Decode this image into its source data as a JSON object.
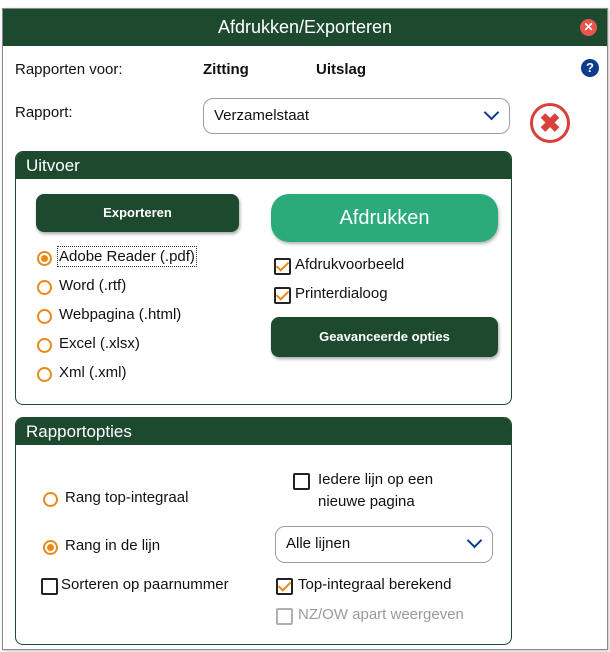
{
  "window": {
    "title": "Afdrukken/Exporteren",
    "close_glyph": "✕"
  },
  "header": {
    "reports_for_label": "Rapporten voor:",
    "tab_zitting": "Zitting",
    "tab_uitslag": "Uitslag",
    "help_glyph": "?"
  },
  "rapport": {
    "label": "Rapport:",
    "selected": "Verzamelstaat"
  },
  "close_icon_glyph": "✖",
  "uitvoer": {
    "title": "Uitvoer",
    "export_label": "Exporteren",
    "print_label": "Afdrukken",
    "advanced_label": "Geavanceerde opties",
    "formats": [
      {
        "label": "Adobe Reader (.pdf)",
        "selected": true
      },
      {
        "label": "Word (.rtf)",
        "selected": false
      },
      {
        "label": "Webpagina (.html)",
        "selected": false
      },
      {
        "label": "Excel (.xlsx)",
        "selected": false
      },
      {
        "label": "Xml (.xml)",
        "selected": false
      }
    ],
    "print_preview": {
      "label": "Afdrukvoorbeeld",
      "checked": true
    },
    "printer_dialog": {
      "label": "Printerdialoog",
      "checked": true
    }
  },
  "rapportopties": {
    "title": "Rapportopties",
    "rang_top": {
      "label": "Rang top-integraal",
      "selected": false
    },
    "rang_lijn": {
      "label": "Rang in de lijn",
      "selected": true
    },
    "new_page_line1": "Iedere lijn op een",
    "new_page_line2": "nieuwe pagina",
    "new_page_checked": false,
    "lines_select": "Alle lijnen",
    "sort_pair": {
      "label": "Sorteren op paarnummer",
      "checked": false
    },
    "top_integral": {
      "label": "Top-integraal berekend",
      "checked": true
    },
    "nz_ow": {
      "label": "NZ/OW apart weergeven",
      "checked": false,
      "disabled": true
    }
  },
  "colors": {
    "dark_green": "#1d4a2e",
    "accent_green": "#2bab7a",
    "orange": "#e88a1a",
    "red": "#d9403a"
  }
}
